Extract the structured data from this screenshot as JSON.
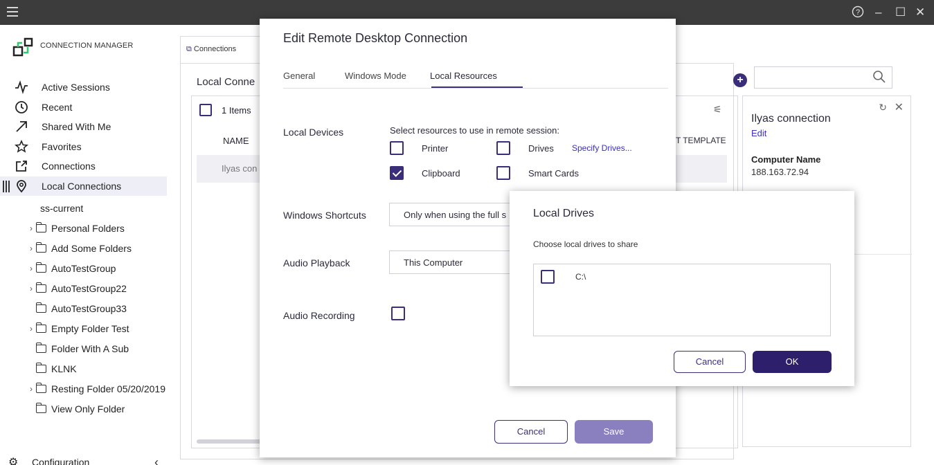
{
  "titlebar": {
    "help_icon": "help-circle-icon",
    "minimize": "–",
    "maximize": "☐",
    "close": "✕"
  },
  "brand": {
    "name": "CONNECTION MANAGER"
  },
  "nav": [
    {
      "label": "Active Sessions",
      "icon": "activity-icon"
    },
    {
      "label": "Recent",
      "icon": "clock-icon"
    },
    {
      "label": "Shared With Me",
      "icon": "arrow-up-right-icon"
    },
    {
      "label": "Favorites",
      "icon": "star-icon"
    },
    {
      "label": "Connections",
      "icon": "external-link-icon"
    },
    {
      "label": "Local Connections",
      "icon": "location-pin-icon"
    }
  ],
  "tree": {
    "root": "ss-current",
    "items": [
      {
        "label": "Personal Folders",
        "expandable": true
      },
      {
        "label": "Add Some Folders",
        "expandable": true
      },
      {
        "label": "AutoTestGroup",
        "expandable": true
      },
      {
        "label": "AutoTestGroup22",
        "expandable": true
      },
      {
        "label": "AutoTestGroup33",
        "expandable": false
      },
      {
        "label": "Empty Folder Test",
        "expandable": true
      },
      {
        "label": "Folder With A Sub",
        "expandable": false
      },
      {
        "label": "KLNK",
        "expandable": false
      },
      {
        "label": "Resting Folder 05/20/2019",
        "expandable": true
      },
      {
        "label": "View Only Folder",
        "expandable": false
      }
    ]
  },
  "config": {
    "label": "Configuration",
    "collapse": "‹"
  },
  "main": {
    "tab_label": "Connections",
    "section_title": "Local Conne",
    "items_count": "1 Items",
    "col_name": "NAME",
    "col_template": "T TEMPLATE",
    "row_name": "Ilyas con"
  },
  "detail": {
    "title": "Ilyas connection",
    "edit": "Edit",
    "computer_label": "Computer Name",
    "computer_value": "188.163.72.94"
  },
  "modal": {
    "title": "Edit Remote Desktop Connection",
    "tabs": [
      "General",
      "Windows Mode",
      "Local Resources"
    ],
    "active_tab": "Local Resources",
    "local_devices_label": "Local Devices",
    "select_resources": "Select resources to use in remote session:",
    "resources": {
      "printer": {
        "label": "Printer",
        "checked": false
      },
      "drives": {
        "label": "Drives",
        "checked": false
      },
      "clipboard": {
        "label": "Clipboard",
        "checked": true
      },
      "smart_cards": {
        "label": "Smart Cards",
        "checked": false
      }
    },
    "specify_drives": "Specify Drives...",
    "windows_shortcuts_label": "Windows Shortcuts",
    "windows_shortcuts_value": "Only when using the full s",
    "audio_playback_label": "Audio Playback",
    "audio_playback_value": "This Computer",
    "audio_recording_label": "Audio Recording",
    "cancel": "Cancel",
    "save": "Save"
  },
  "drives_dialog": {
    "title": "Local Drives",
    "subtitle": "Choose local drives to share",
    "drives": [
      {
        "label": "C:\\",
        "checked": false
      }
    ],
    "cancel": "Cancel",
    "ok": "OK"
  },
  "colors": {
    "accent": "#3a2d7a",
    "link": "#3a2dc9",
    "titlebar": "#3c3c3c"
  }
}
